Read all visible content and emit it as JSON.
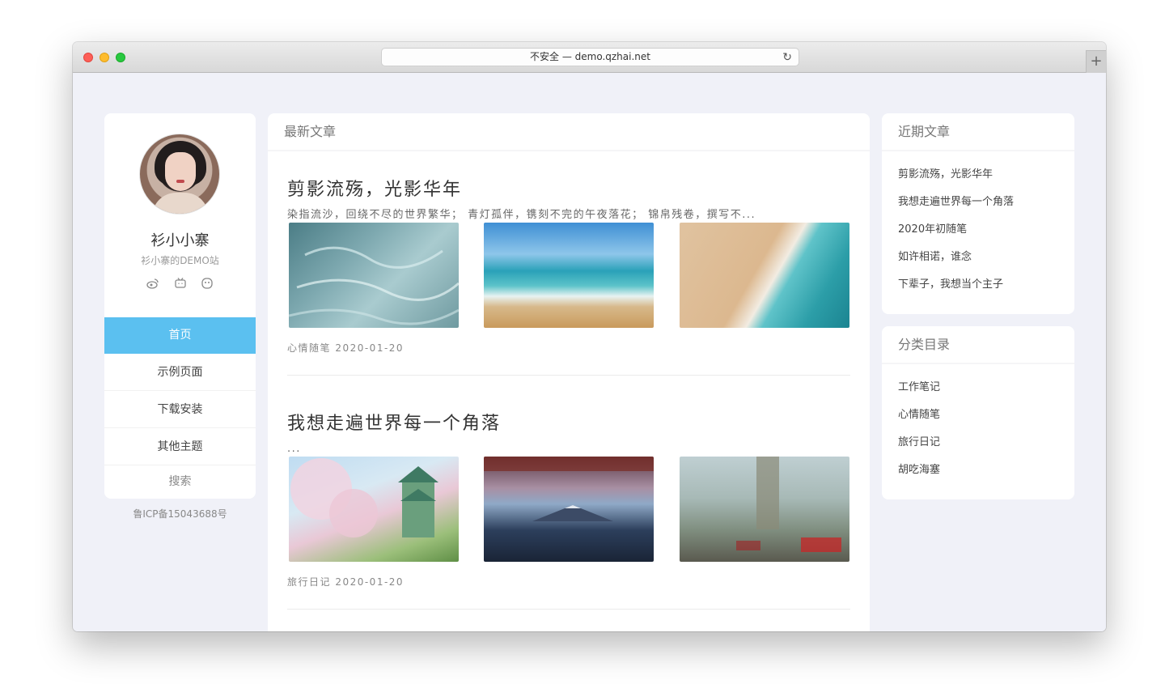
{
  "browser": {
    "url_text": "不安全 — demo.qzhai.net",
    "reload_glyph": "↻",
    "new_tab_glyph": "+"
  },
  "profile": {
    "name": "衫小小寨",
    "description": "衫小寨的DEMO站",
    "social_icons": [
      "weibo-icon",
      "bilibili-icon",
      "qq-icon"
    ],
    "nav": [
      "首页",
      "示例页面",
      "下载安装",
      "其他主题",
      "搜索"
    ],
    "icp": "鲁ICP备15043688号"
  },
  "main": {
    "header": "最新文章",
    "posts": [
      {
        "title": "剪影流殇，光影华年",
        "excerpt": "染指流沙，回绕不尽的世界繁华；  青灯孤伴，镌刻不完的午夜落花；  锦帛残卷，撰写不...",
        "meta": "心情随笔 2020-01-20"
      },
      {
        "title": "我想走遍世界每一个角落",
        "excerpt": "...",
        "meta": "旅行日记 2020-01-20"
      }
    ]
  },
  "sidebar": {
    "recent": {
      "title": "近期文章",
      "items": [
        "剪影流殇，光影华年",
        "我想走遍世界每一个角落",
        "2020年初随笔",
        "如许相诺，谁念",
        "下辈子，我想当个主子"
      ]
    },
    "categories": {
      "title": "分类目录",
      "items": [
        "工作笔记",
        "心情随笔",
        "旅行日记",
        "胡吃海塞"
      ]
    }
  },
  "colors": {
    "accent": "#5bc0f0",
    "background": "#f0f1f8"
  }
}
